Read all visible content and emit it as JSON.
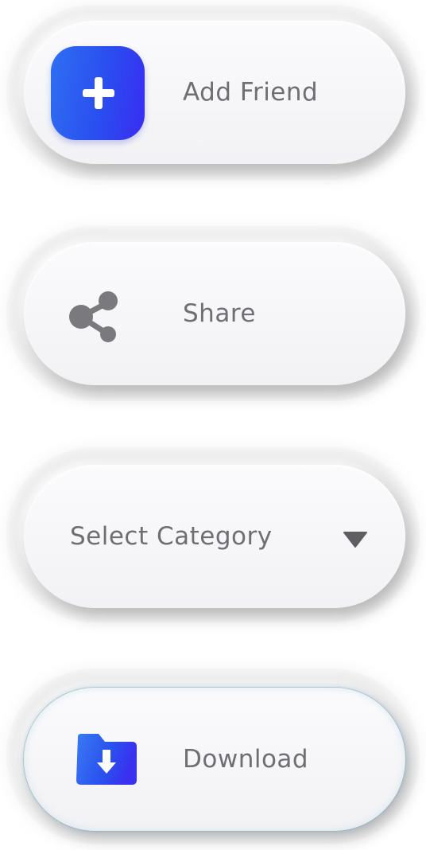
{
  "buttons": {
    "add_friend": {
      "label": "Add Friend",
      "icon": "plus-icon"
    },
    "share": {
      "label": "Share",
      "icon": "share-icon"
    },
    "select_category": {
      "label": "Select Category",
      "icon": "caret-down-icon"
    },
    "download": {
      "label": "Download",
      "icon": "folder-download-icon"
    }
  },
  "colors": {
    "accent_blue": "#2a4ef0",
    "accent_violet": "#3a2cf2",
    "icon_gray": "#7a7a7e",
    "text_gray": "#6e6e73"
  }
}
